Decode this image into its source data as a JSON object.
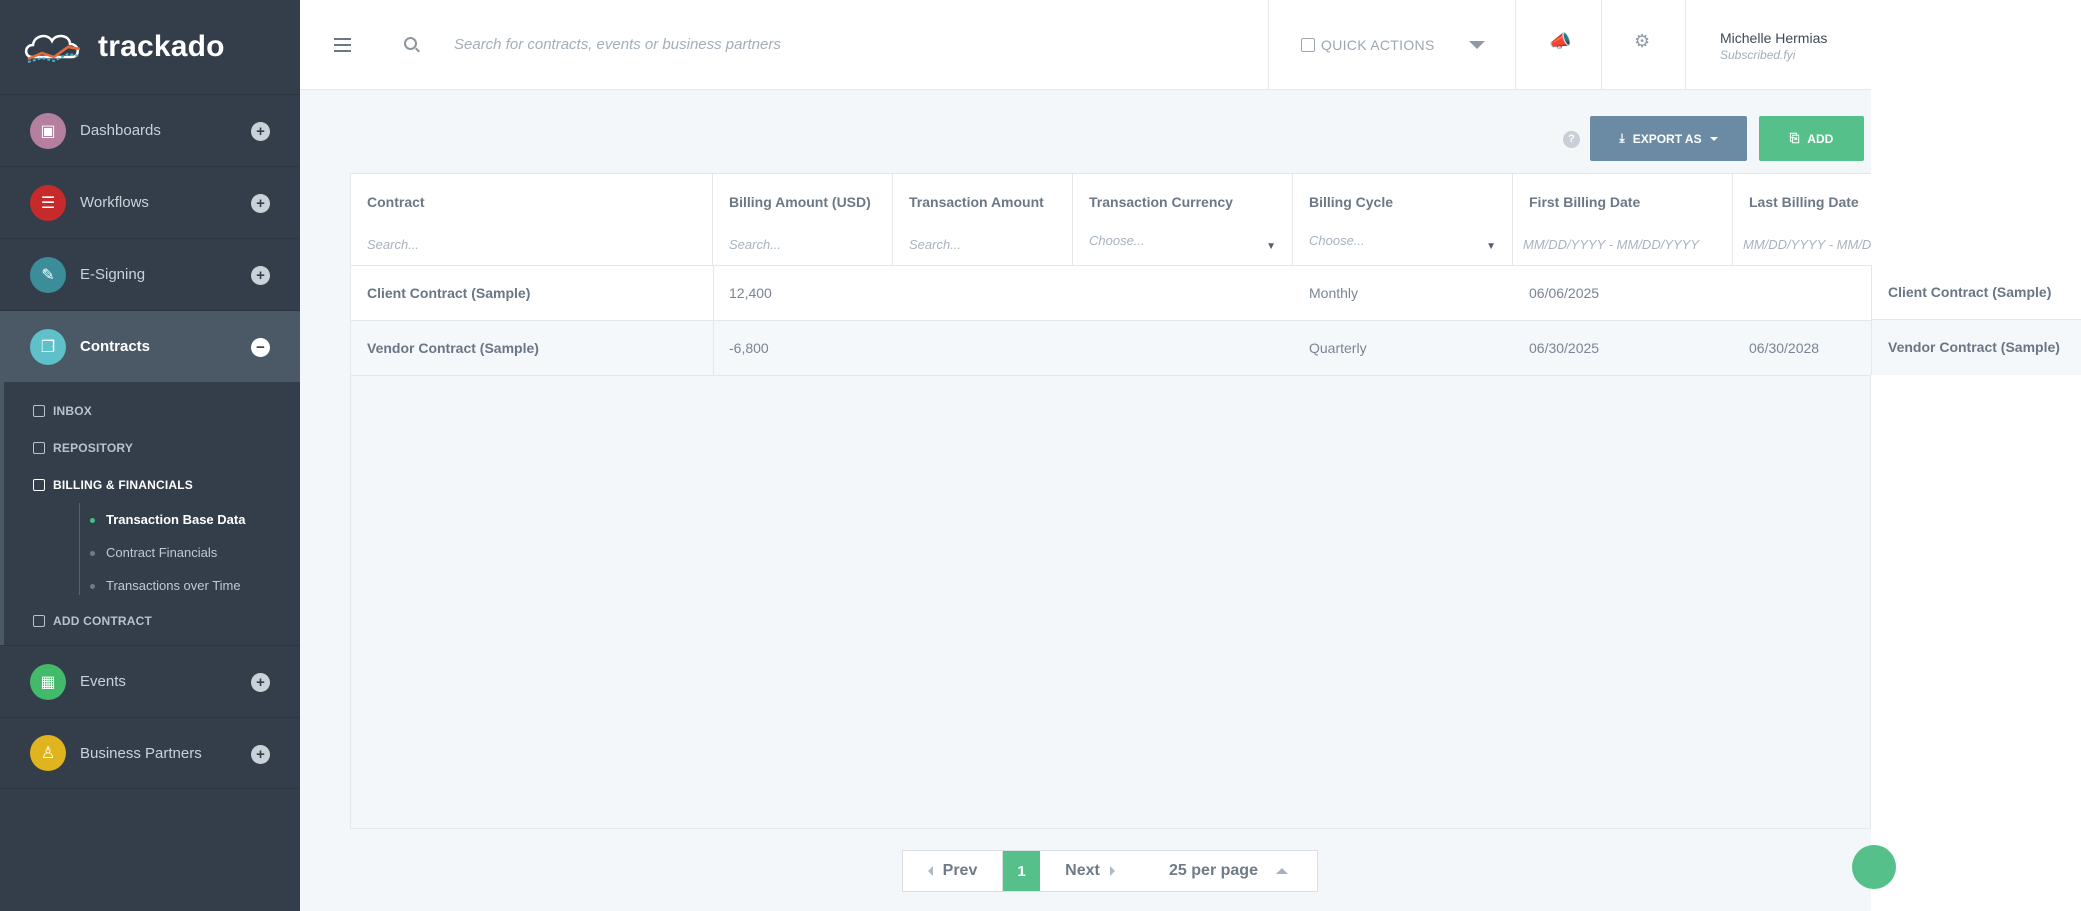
{
  "app": {
    "logo_text": "trackado"
  },
  "sidebar": {
    "items": [
      {
        "label": "Dashboards",
        "color": "#b5809f"
      },
      {
        "label": "Workflows",
        "color": "#c62a2a"
      },
      {
        "label": "E-Signing",
        "color": "#3c8d9a"
      },
      {
        "label": "Contracts",
        "color": "#5ec1c9"
      },
      {
        "label": "Events",
        "color": "#43b96a"
      },
      {
        "label": "Business Partners",
        "color": "#e0b41e"
      }
    ],
    "contracts_sub": {
      "inbox": "INBOX",
      "repository": "REPOSITORY",
      "billing": "BILLING & FINANCIALS",
      "billing_children": [
        "Transaction Base Data",
        "Contract Financials",
        "Transactions over Time"
      ],
      "add_contract": "ADD CONTRACT"
    }
  },
  "header": {
    "search_placeholder": "Search for contracts, events or business partners",
    "quick_actions": "QUICK ACTIONS",
    "user_name": "Michelle Hermias",
    "user_sub": "Subscribed.fyi"
  },
  "toolbar": {
    "help": "?",
    "export_label": "EXPORT AS",
    "add_label": "ADD"
  },
  "table": {
    "columns": [
      {
        "title": "Contract",
        "filter": "Search..."
      },
      {
        "title": "Billing Amount (USD)",
        "filter": "Search..."
      },
      {
        "title": "Transaction Amount",
        "filter": "Search..."
      },
      {
        "title": "Transaction Currency",
        "filter": "Choose..."
      },
      {
        "title": "Billing Cycle",
        "filter": "Choose..."
      },
      {
        "title": "First Billing Date",
        "filter": "MM/DD/YYYY  -  MM/DD/YYYY"
      },
      {
        "title": "Last Billing Date",
        "filter": "MM/DD/YYYY  -  MM/DD/YYYY"
      }
    ],
    "rows": [
      {
        "contract": "Client Contract (Sample)",
        "billing_amount": "12,400",
        "transaction_amount": "",
        "currency": "",
        "cycle": "Monthly",
        "first_date": "06/06/2025",
        "last_date": ""
      },
      {
        "contract": "Vendor Contract (Sample)",
        "billing_amount": "-6,800",
        "transaction_amount": "",
        "currency": "",
        "cycle": "Quarterly",
        "first_date": "06/30/2025",
        "last_date": "06/30/2028"
      }
    ],
    "right_rows": [
      "Client Contract (Sample)",
      "Vendor Contract (Sample)"
    ]
  },
  "pagination": {
    "prev": "Prev",
    "page": "1",
    "next": "Next",
    "per_page": "25 per page"
  }
}
